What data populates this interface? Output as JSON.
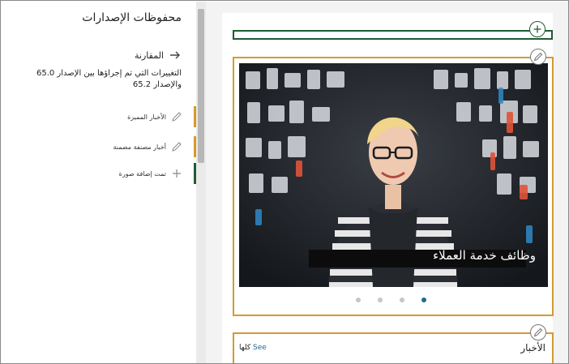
{
  "history": {
    "title": "محفوظات الإصدارات",
    "compare_label": "المقارنة",
    "changes_description": "التغييرات التي تم إجراؤها بين الإصدار 65.0 والإصدار 65.2",
    "items": [
      {
        "label": "الأخبار المميزة",
        "type": "modified",
        "icon": "pencil-icon"
      },
      {
        "label": "أخبار مصنفة مضمنة",
        "type": "modified",
        "icon": "pencil-icon"
      },
      {
        "label": "تمت إضافة صورة",
        "type": "added",
        "icon": "plus-icon"
      }
    ]
  },
  "hero": {
    "caption": "وظائف خدمة العملاء",
    "slide_count": 4,
    "active_slide": 4
  },
  "news": {
    "title": "الأخبار",
    "see_all_link": "See",
    "see_all_suffix": "كلها"
  },
  "colors": {
    "modified": "#d69a2d",
    "added": "#1e5c32",
    "link": "#1b6a8f"
  }
}
